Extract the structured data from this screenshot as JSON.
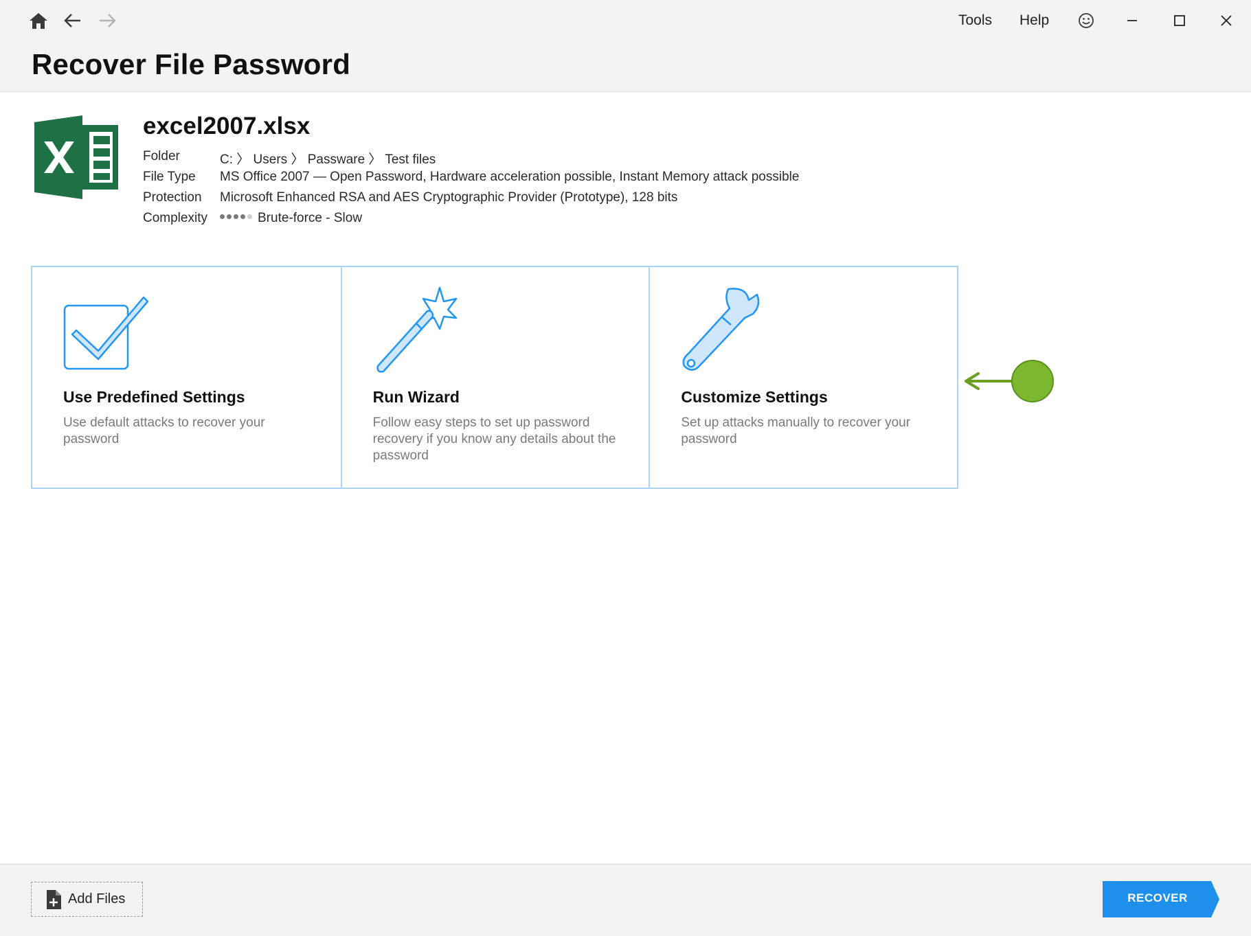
{
  "nav": {
    "home_icon": "home-icon",
    "back_icon": "arrow-left-icon",
    "forward_icon": "arrow-right-icon"
  },
  "menu": {
    "tools": "Tools",
    "help": "Help",
    "feedback_icon": "smiley-icon"
  },
  "window_controls": [
    "minimize-icon",
    "maximize-icon",
    "close-icon"
  ],
  "page_title": "Recover File Password",
  "file": {
    "name": "excel2007.xlsx",
    "icon": "excel-file-icon",
    "icon_color": "#1e7145",
    "details": [
      {
        "label": "Folder",
        "value": "C: 〉 Users 〉 Passware 〉 Test files"
      },
      {
        "label": "File Type",
        "value": "MS Office 2007 — Open Password, Hardware acceleration possible, Instant Memory attack possible"
      },
      {
        "label": "Protection",
        "value": "Microsoft Enhanced RSA and AES Cryptographic Provider (Prototype), 128 bits"
      },
      {
        "label": "Complexity",
        "value": "Brute-force - Slow"
      }
    ],
    "complexity_level": 4,
    "complexity_max": 5
  },
  "options": [
    {
      "icon": "checkbox-check-icon",
      "title": "Use Predefined Settings",
      "description": "Use default attacks to recover your password"
    },
    {
      "icon": "magic-wand-icon",
      "title": "Run Wizard",
      "description": "Follow easy steps to set up password recovery if you know any details about the password"
    },
    {
      "icon": "wrench-icon",
      "title": "Customize Settings",
      "description": "Set up attacks manually to recover your password"
    }
  ],
  "annotation": {
    "icon": "green-pointer-arrow-icon",
    "color": "#7cb82f"
  },
  "footer": {
    "add_files_label": "Add Files",
    "add_files_icon": "add-file-icon",
    "recover_label": "RECOVER"
  },
  "colors": {
    "accent": "#1e90ec",
    "card_border": "#a9d4f5",
    "icon_stroke": "#2196f3",
    "icon_fill": "#cfe6fb"
  }
}
